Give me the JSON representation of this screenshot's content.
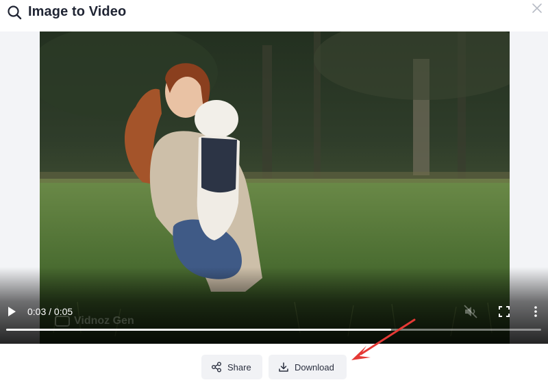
{
  "header": {
    "title": "Image to Video",
    "title_icon": "search-icon",
    "close_icon": "close-icon"
  },
  "player": {
    "time_display": "0:03 / 0:05",
    "progress": 0.72,
    "watermark": "Vidnoz Gen",
    "icons": [
      "play-icon",
      "mute-icon",
      "fullscreen-icon",
      "more-vert-icon"
    ]
  },
  "actions": {
    "share_label": "Share",
    "download_label": "Download"
  },
  "annotation": {
    "arrow_color": "#e53935"
  },
  "colors": {
    "title_text": "#1f2433",
    "button_bg": "#f1f2f5",
    "annotation_arrow": "#e53935"
  }
}
